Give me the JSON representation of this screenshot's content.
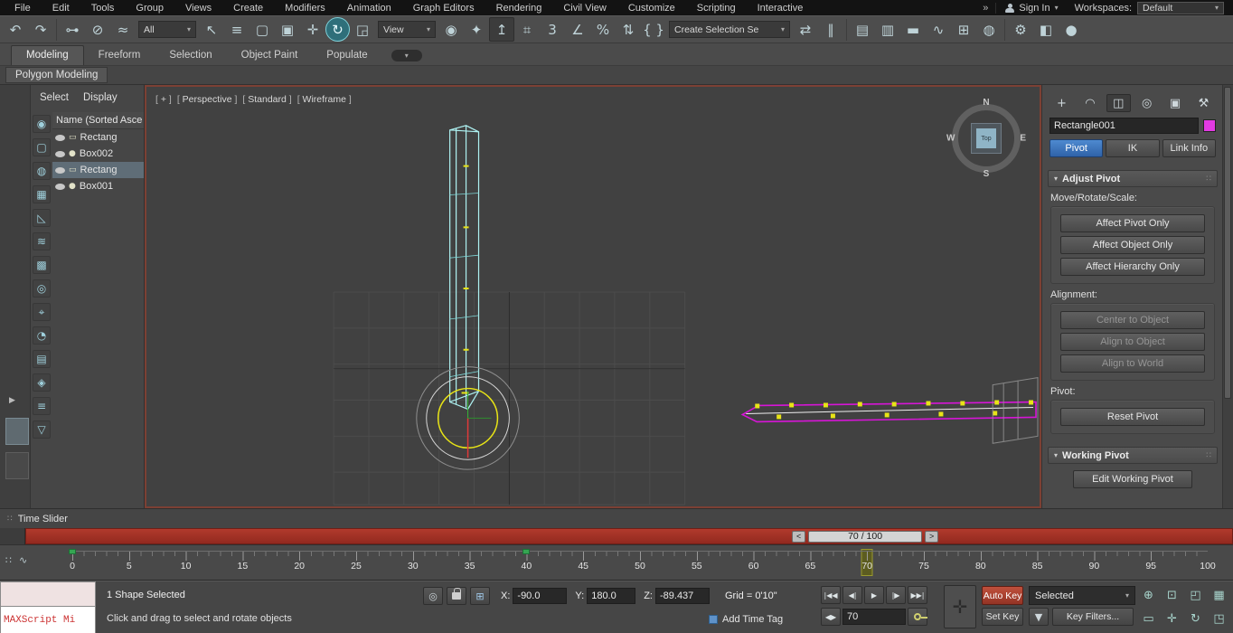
{
  "menu": {
    "items": [
      "File",
      "Edit",
      "Tools",
      "Group",
      "Views",
      "Create",
      "Modifiers",
      "Animation",
      "Graph Editors",
      "Rendering",
      "Civil View",
      "Customize",
      "Scripting",
      "Interactive"
    ],
    "overflow": "»",
    "sign_in": "Sign In",
    "workspaces_label": "Workspaces:",
    "workspace_value": "Default"
  },
  "toolbar": {
    "selection_filter": "All",
    "coord_system": "View",
    "selection_set_field": "Create Selection Se"
  },
  "icons": {
    "caret": "▾",
    "grip": "∷",
    "expand": "▶",
    "undo": "↶",
    "redo": "↷",
    "link": "⊶",
    "unlink": "⊘",
    "bind": "≈",
    "select": "↖",
    "select_by_name": "≡",
    "rect_region": "▢",
    "window_crossing": "▣",
    "move": "✛",
    "rotate": "↻",
    "scale": "◲",
    "place": "↥",
    "pivot_center": "◉",
    "manipulate": "✦",
    "kbd": "⌗",
    "snap3": "3",
    "angle": "∠",
    "percent": "%",
    "spinner": "⇅",
    "selset": "{ }",
    "mirror": "⇄",
    "align": "∥",
    "scene_exp": "▤",
    "layer_exp": "▥",
    "ribbon": "▬",
    "curve": "∿",
    "schematic": "⊞",
    "material": "◍",
    "render_setup": "⚙",
    "rfw": "◧",
    "render": "●",
    "create_tab": "+",
    "modify_tab": "◠",
    "hierarchy_tab": "◫",
    "motion_tab": "◎",
    "display_tab": "▣",
    "utilities_tab": "⚒",
    "shape": "▭",
    "geom": "●",
    "isolate": "◎",
    "absolute": "⊞",
    "spin": "◀▶",
    "bigplus": "✛",
    "filter": "▼"
  },
  "ribbon": {
    "tabs": [
      "Modeling",
      "Freeform",
      "Selection",
      "Object Paint",
      "Populate"
    ],
    "subtab": "Polygon Modeling"
  },
  "explorer": {
    "menu_select": "Select",
    "menu_display": "Display",
    "header": "Name (Sorted Asce",
    "tools": [
      "◉",
      "▢",
      "◍",
      "▦",
      "◺",
      "≋",
      "▩",
      "◎",
      "⌖",
      "◔",
      "▤",
      "◈",
      "≡",
      "▽"
    ],
    "rows": [
      {
        "label": "Rectang"
      },
      {
        "label": "Box002"
      },
      {
        "label": "Rectang"
      },
      {
        "label": "Box001"
      }
    ]
  },
  "viewport": {
    "menus": [
      "+",
      "Perspective",
      "Standard",
      "Wireframe"
    ],
    "viewcube": {
      "n": "N",
      "w": "W",
      "e": "E",
      "s": "S",
      "face": "Top"
    }
  },
  "command_panel": {
    "object_name": "Rectangle001",
    "modes": [
      "Pivot",
      "IK",
      "Link Info"
    ],
    "adjust_pivot": {
      "title": "Adjust Pivot",
      "move_label": "Move/Rotate/Scale:",
      "buttons": [
        "Affect Pivot Only",
        "Affect Object Only",
        "Affect Hierarchy Only"
      ],
      "align_label": "Alignment:",
      "align_buttons": [
        "Center to Object",
        "Align to Object",
        "Align to World"
      ],
      "pivot_label": "Pivot:",
      "reset_button": "Reset Pivot"
    },
    "working_pivot": {
      "title": "Working Pivot",
      "edit_button": "Edit Working Pivot"
    }
  },
  "time_slider": {
    "label": "Time Slider",
    "frame_display": "70 / 100",
    "prev": "<",
    "next": ">"
  },
  "timeline": {
    "ticks": [
      "0",
      "5",
      "10",
      "15",
      "20",
      "25",
      "30",
      "35",
      "40",
      "45",
      "50",
      "55",
      "60",
      "65",
      "70",
      "75",
      "80",
      "85",
      "90",
      "95",
      "100"
    ],
    "current_frame": 70,
    "key_frames": [
      0,
      40
    ]
  },
  "status_bar": {
    "maxscript_label": "MAXScript Mi",
    "selection_status": "1 Shape Selected",
    "prompt": "Click and drag to select and rotate objects",
    "x_label": "X:",
    "x_value": "-90.0",
    "y_label": "Y:",
    "y_value": "180.0",
    "z_label": "Z:",
    "z_value": "-89.437",
    "grid_label": "Grid = 0'10\"",
    "add_time_tag": "Add Time Tag",
    "playback": [
      "|◀◀",
      "◀|",
      "▶",
      "|▶",
      "▶▶|"
    ],
    "auto_key": "Auto Key",
    "set_key": "Set Key",
    "key_mode": "Selected",
    "frame_value": "70",
    "key_filters": "Key Filters...",
    "nav_icons": [
      "⊕",
      "⊡",
      "◰",
      "▦",
      "▭",
      "✛",
      "↻",
      "◳"
    ]
  }
}
